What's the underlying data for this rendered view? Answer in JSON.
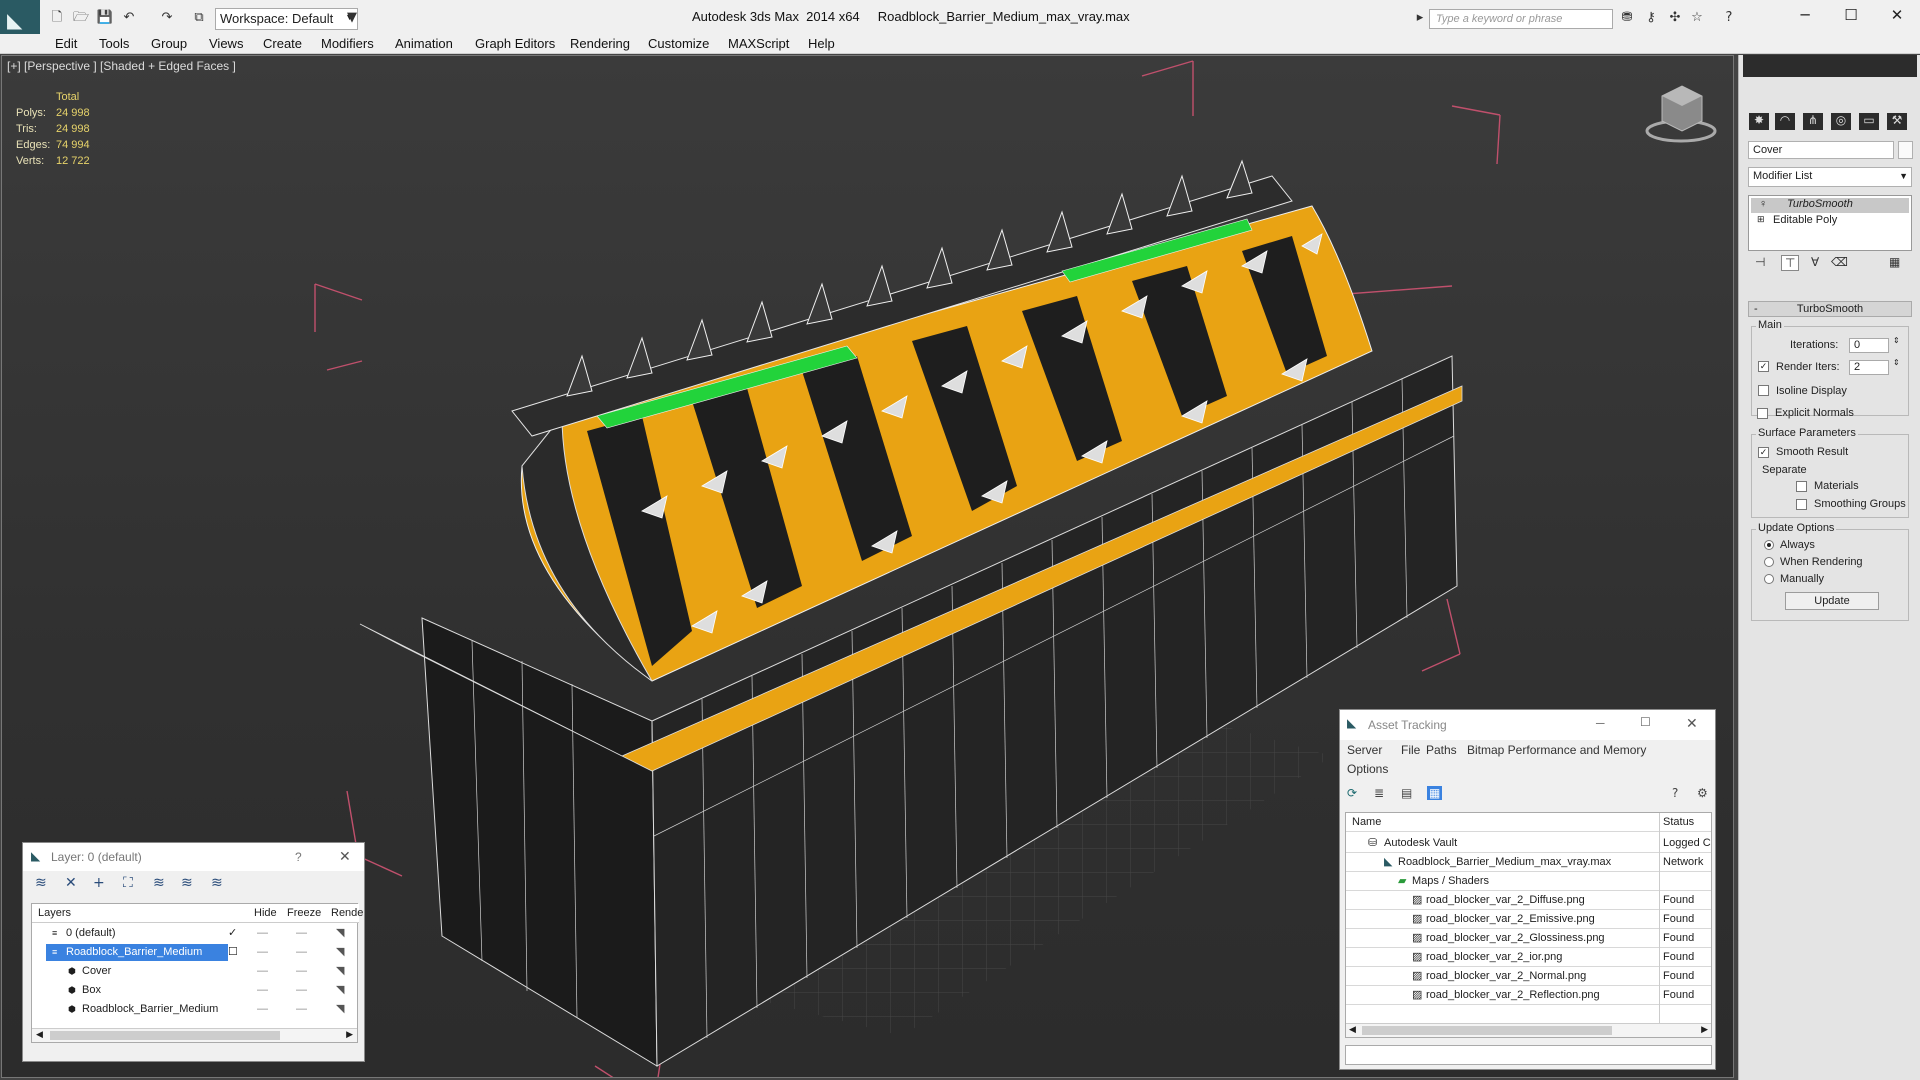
{
  "titlebar": {
    "workspace_label": "Workspace: Default",
    "app_title": "Autodesk 3ds Max  2014 x64     Roadblock_Barrier_Medium_max_vray.max",
    "search_placeholder": "Type a keyword or phrase"
  },
  "menu": [
    "Edit",
    "Tools",
    "Group",
    "Views",
    "Create",
    "Modifiers",
    "Animation",
    "Graph Editors",
    "Rendering",
    "Customize",
    "MAXScript",
    "Help"
  ],
  "viewport": {
    "label": "[+] [Perspective ] [Shaded + Edged Faces ]",
    "stats": {
      "header": "Total",
      "rows": [
        {
          "k": "Polys:",
          "v": "24 998"
        },
        {
          "k": "Tris:",
          "v": "24 998"
        },
        {
          "k": "Edges:",
          "v": "74 994"
        },
        {
          "k": "Verts:",
          "v": "12 722"
        }
      ]
    },
    "colors": {
      "stripe": "#e9a313",
      "body": "#1f1f1f",
      "green": "#22d33b",
      "bbox": "#c0506c"
    }
  },
  "modify_panel": {
    "object_name": "Cover",
    "modifier_list": "Modifier List",
    "stack": [
      "TurboSmooth",
      "Editable Poly"
    ],
    "rollout": "TurboSmooth",
    "main_label": "Main",
    "iterations_label": "Iterations:",
    "iterations_value": "0",
    "render_iters_label": "Render Iters:",
    "render_iters_value": "2",
    "isoline": "Isoline Display",
    "explicit": "Explicit Normals",
    "surface_label": "Surface Parameters",
    "smooth_result": "Smooth Result",
    "separate_label": "Separate",
    "materials": "Materials",
    "smoothing_groups": "Smoothing Groups",
    "update_label": "Update Options",
    "always": "Always",
    "when_rendering": "When Rendering",
    "manually": "Manually",
    "update_button": "Update"
  },
  "layer_window": {
    "title": "Layer: 0 (default)",
    "help": "?",
    "columns": [
      "Layers",
      "Hide",
      "Freeze",
      "Rende"
    ],
    "rows": [
      "0 (default)",
      "Roadblock_Barrier_Medium",
      "Cover",
      "Box",
      "Roadblock_Barrier_Medium"
    ]
  },
  "asset_window": {
    "title": "Asset Tracking",
    "menu": [
      "Server",
      "File",
      "Paths",
      "Bitmap Performance and Memory",
      "Options"
    ],
    "columns": [
      "Name",
      "Status"
    ],
    "rows": [
      {
        "name": "Autodesk Vault",
        "status": "Logged C"
      },
      {
        "name": "Roadblock_Barrier_Medium_max_vray.max",
        "status": "Network"
      },
      {
        "name": "Maps / Shaders",
        "status": ""
      },
      {
        "name": "road_blocker_var_2_Diffuse.png",
        "status": "Found"
      },
      {
        "name": "road_blocker_var_2_Emissive.png",
        "status": "Found"
      },
      {
        "name": "road_blocker_var_2_Glossiness.png",
        "status": "Found"
      },
      {
        "name": "road_blocker_var_2_ior.png",
        "status": "Found"
      },
      {
        "name": "road_blocker_var_2_Normal.png",
        "status": "Found"
      },
      {
        "name": "road_blocker_var_2_Reflection.png",
        "status": "Found"
      }
    ]
  }
}
